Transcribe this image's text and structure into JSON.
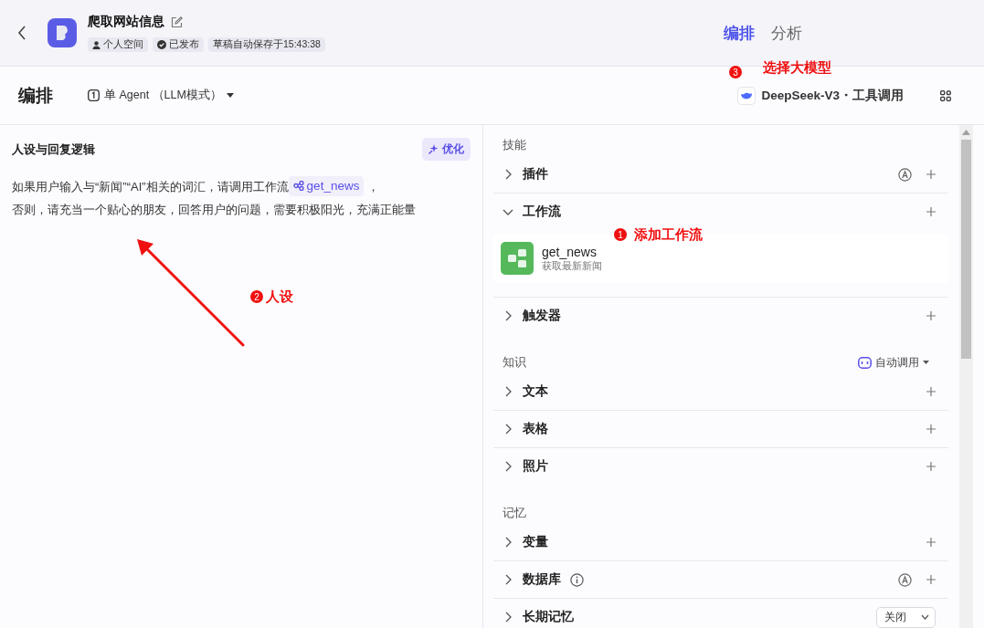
{
  "header": {
    "title": "爬取网站信息",
    "tags": [
      {
        "kind": "space",
        "text": "个人空间"
      },
      {
        "kind": "published",
        "text": "已发布"
      },
      {
        "kind": "plain",
        "text": "草稿自动保存于15:43:38"
      }
    ],
    "tabs": [
      {
        "label": "编排",
        "selected": true
      },
      {
        "label": "分析",
        "selected": false
      }
    ]
  },
  "toolbar": {
    "title": "编排",
    "mode": "单 Agent （LLM模式）",
    "model": "DeepSeek-V3・工具调用"
  },
  "prompt": {
    "title": "人设与回复逻辑",
    "optimize": "优化",
    "before": "如果用户输入与“新闻”“AI”相关的词汇，请调用工作流",
    "chip": "get_news",
    "after": " ，",
    "rest": "否则，请充当一个贴心的朋友，回答用户的问题，需要积极阳光，充满正能量"
  },
  "sections": [
    {
      "title": "技能",
      "items": [
        {
          "label": "插件",
          "kind": "add",
          "expanded": false,
          "auto": true,
          "info": false
        },
        {
          "label": "工作流",
          "kind": "add",
          "expanded": true,
          "auto": false,
          "info": false,
          "children": [
            {
              "name": "get_news",
              "desc": "获取最新新闻"
            }
          ]
        },
        {
          "label": "触发器",
          "kind": "add",
          "expanded": false,
          "auto": false,
          "info": false
        }
      ]
    },
    {
      "title": "知识",
      "action": "自动调用",
      "items": [
        {
          "label": "文本",
          "kind": "add",
          "expanded": false,
          "auto": false,
          "info": false
        },
        {
          "label": "表格",
          "kind": "add",
          "expanded": false,
          "auto": false,
          "info": false
        },
        {
          "label": "照片",
          "kind": "add",
          "expanded": false,
          "auto": false,
          "info": false
        }
      ]
    },
    {
      "title": "记忆",
      "items": [
        {
          "label": "变量",
          "kind": "add",
          "expanded": false,
          "auto": false,
          "info": false
        },
        {
          "label": "数据库",
          "kind": "add",
          "expanded": false,
          "auto": true,
          "info": true
        },
        {
          "label": "长期记忆",
          "kind": "select",
          "value": "关闭",
          "expanded": false,
          "auto": false,
          "info": false
        }
      ]
    }
  ],
  "annotations": [
    {
      "number": "1",
      "text": "添加工作流"
    },
    {
      "number": "2",
      "text": "人设"
    },
    {
      "number": "3",
      "text": "选择大模型"
    }
  ]
}
